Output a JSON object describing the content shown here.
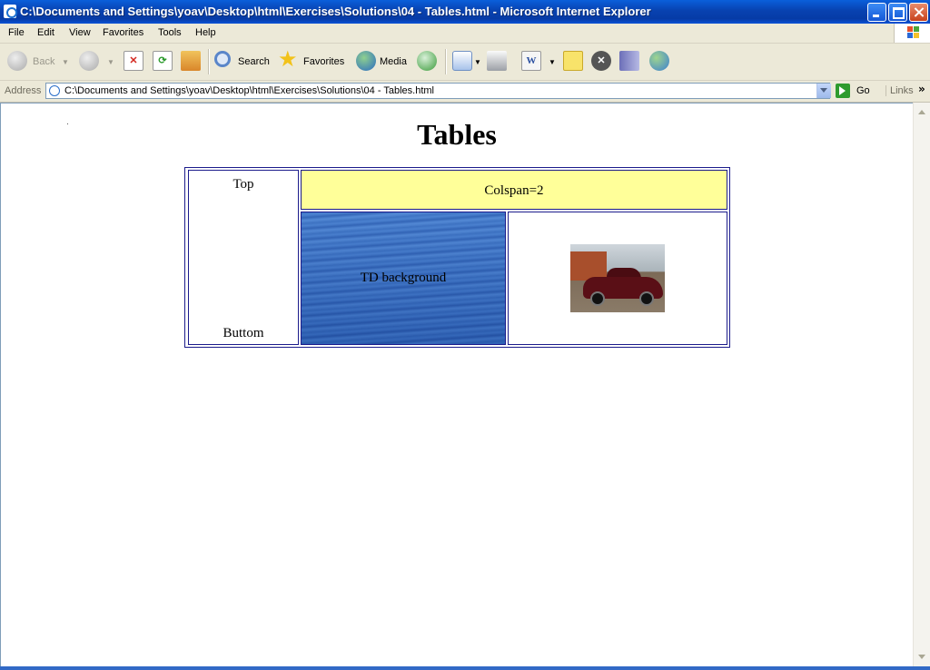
{
  "window": {
    "title": "C:\\Documents and Settings\\yoav\\Desktop\\html\\Exercises\\Solutions\\04 - Tables.html - Microsoft Internet Explorer"
  },
  "menu": {
    "items": [
      {
        "label": "File"
      },
      {
        "label": "Edit"
      },
      {
        "label": "View"
      },
      {
        "label": "Favorites"
      },
      {
        "label": "Tools"
      },
      {
        "label": "Help"
      }
    ]
  },
  "toolbar": {
    "back_label": "Back",
    "search_label": "Search",
    "favorites_label": "Favorites",
    "media_label": "Media"
  },
  "address": {
    "label": "Address",
    "value": "C:\\Documents and Settings\\yoav\\Desktop\\html\\Exercises\\Solutions\\04 - Tables.html",
    "go_label": "Go",
    "links_label": "Links"
  },
  "page": {
    "heading": "Tables",
    "table": {
      "top": "Top",
      "bottom": "Buttom",
      "colspan": "Colspan=2",
      "td_background": "TD background"
    }
  },
  "colors": {
    "titlebar": "#0842b0",
    "colspan_cell_bg": "#ffff99",
    "table_border": "#1c1c8c"
  }
}
